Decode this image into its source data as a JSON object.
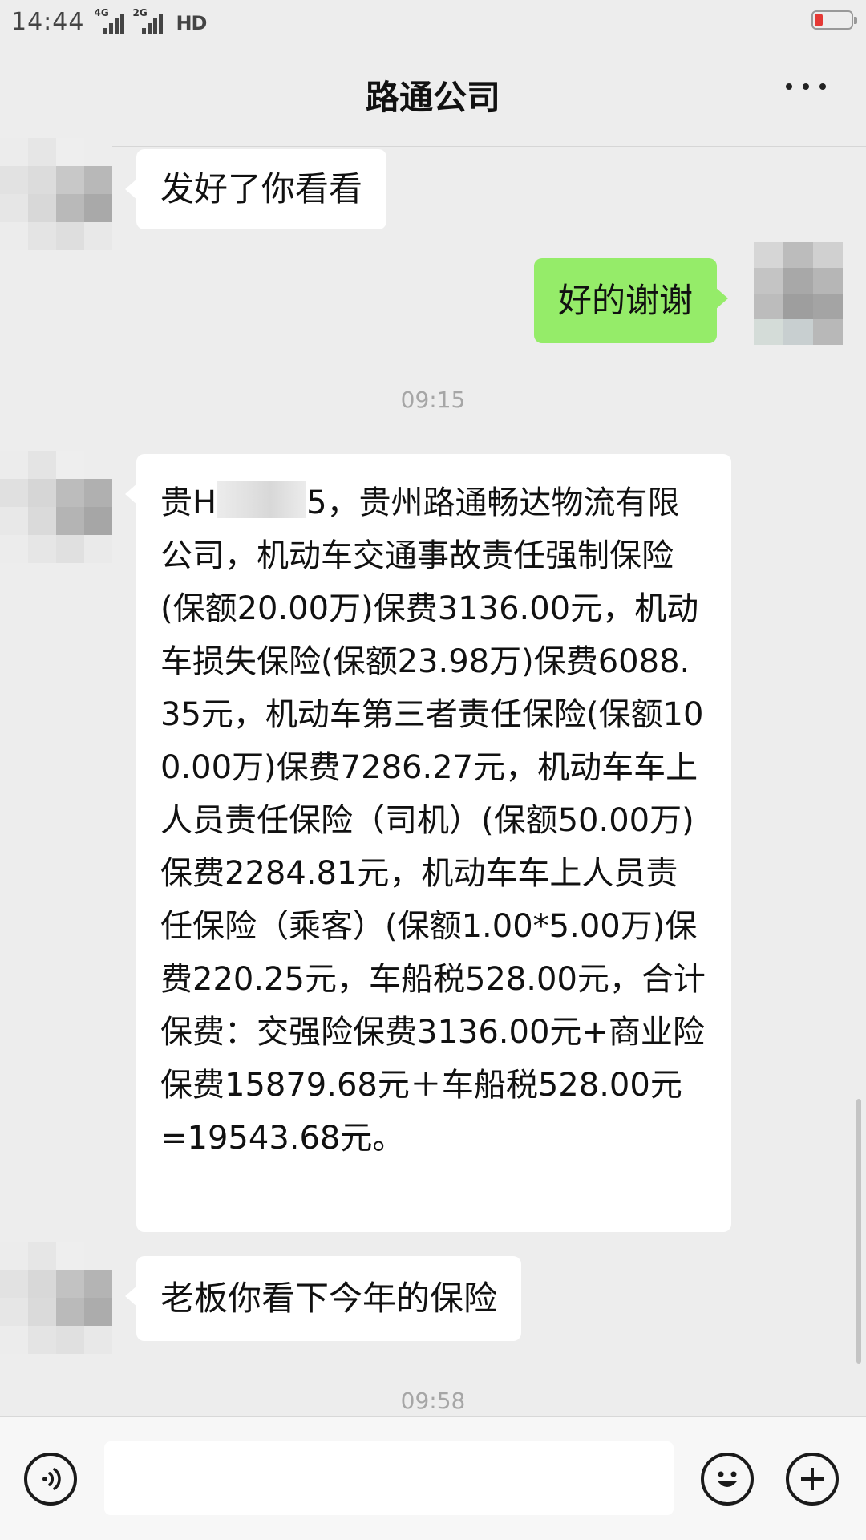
{
  "status_bar": {
    "time": "14:44",
    "network_1": "4G",
    "network_2": "2G",
    "hd_label": "HD",
    "battery_color": "#e53935"
  },
  "header": {
    "title": "路通公司",
    "more_icon": "more-dots-icon"
  },
  "messages": [
    {
      "side": "left",
      "text": "发好了你看看"
    },
    {
      "side": "right",
      "text": "好的谢谢"
    },
    {
      "type": "timestamp",
      "text": "09:15"
    },
    {
      "side": "left",
      "prefix": "贵H",
      "text": "5，贵州路通畅达物流有限公司，机动车交通事故责任强制保险(保额20.00万)保费3136.00元，机动车损失保险(保额23.98万)保费6088.35元，机动车第三者责任保险(保额100.00万)保费7286.27元，机动车车上人员责任保险（司机）(保额50.00万)保费2284.81元，机动车车上人员责任保险（乘客）(保额1.00*5.00万)保费220.25元，车船税528.00元，合计保费：交强险保费3136.00元+商业险保费15879.68元＋车船税528.00元=19543.68元。"
    },
    {
      "side": "left",
      "text": "老板你看下今年的保险"
    },
    {
      "type": "timestamp",
      "text": "09:58"
    }
  ],
  "input_bar": {
    "voice_icon": "voice-icon",
    "emoji_icon": "emoji-icon",
    "plus_icon": "plus-icon",
    "input_value": ""
  },
  "colors": {
    "background": "#ededed",
    "bubble_left": "#ffffff",
    "bubble_right": "#95ec69",
    "timestamp": "#a6a6a6"
  }
}
